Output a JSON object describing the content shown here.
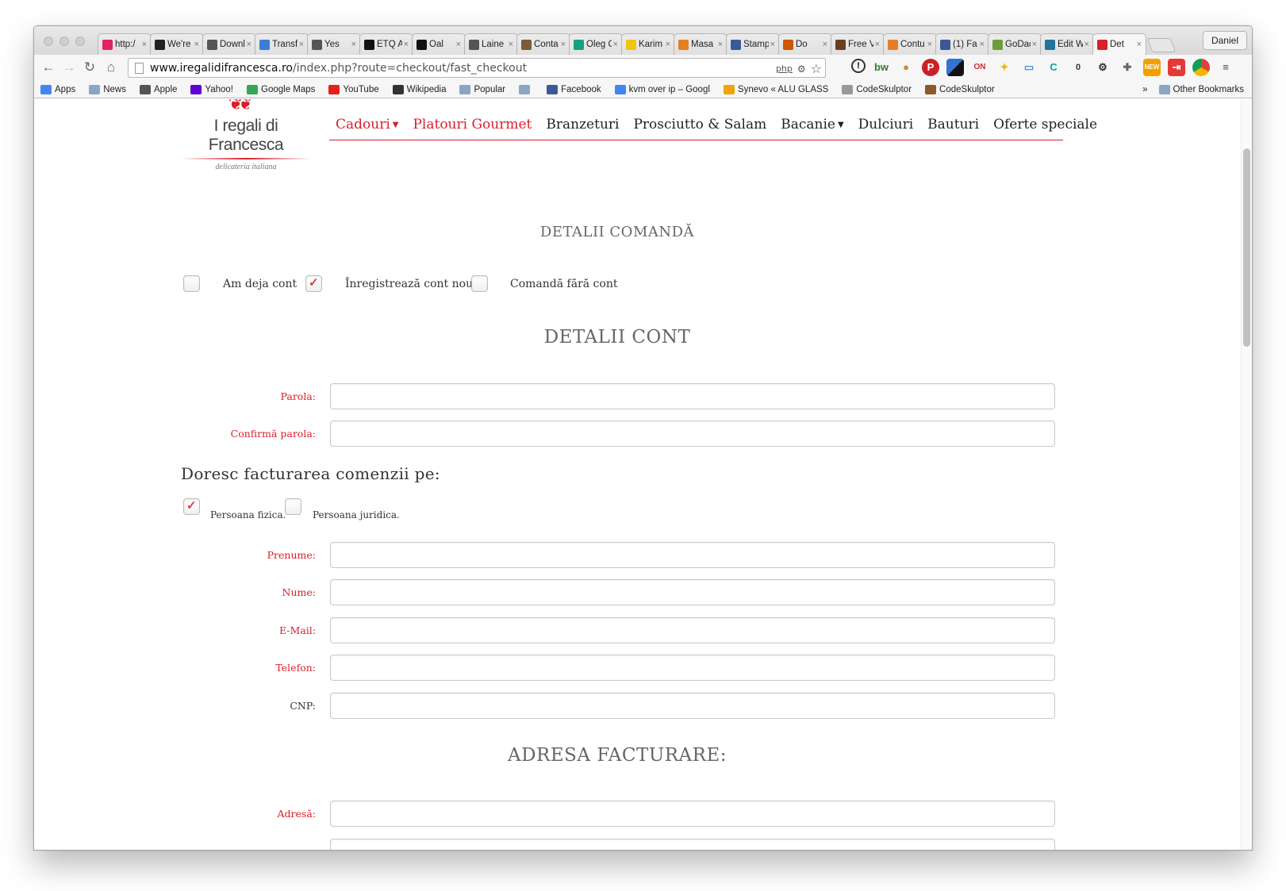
{
  "browser": {
    "tabs": [
      {
        "label": "http:/",
        "icon": "bookmark-icon",
        "color": "#e0245e"
      },
      {
        "label": "We're",
        "icon": "medium-icon",
        "color": "#222222"
      },
      {
        "label": "Downl",
        "icon": "download-icon",
        "color": "#555555"
      },
      {
        "label": "Transf",
        "icon": "triangle-icon",
        "color": "#3b7dd8"
      },
      {
        "label": "Yes",
        "icon": "circle-icon",
        "color": "#555555"
      },
      {
        "label": "ETQ A",
        "icon": "square-icon",
        "color": "#111111"
      },
      {
        "label": "Oal",
        "icon": "o-icon",
        "color": "#111111"
      },
      {
        "label": "Laine",
        "icon": "hand-icon",
        "color": "#555555"
      },
      {
        "label": "Conta",
        "icon": "lock-icon",
        "color": "#7a5b3a"
      },
      {
        "label": "Oleg C",
        "icon": "square-icon",
        "color": "#16a085"
      },
      {
        "label": "Karim",
        "icon": "plus-icon",
        "color": "#f1c40f"
      },
      {
        "label": "Masa",
        "icon": "olx-icon",
        "color": "#e67e22"
      },
      {
        "label": "Stamp",
        "icon": "stamp-icon",
        "color": "#3b5998"
      },
      {
        "label": "Do",
        "icon": "doc-icon",
        "color": "#d35400"
      },
      {
        "label": "Free V",
        "icon": "ffp-icon",
        "color": "#6b3e1f"
      },
      {
        "label": "Contu",
        "icon": "olx-icon",
        "color": "#e67e22"
      },
      {
        "label": "(1) Fa",
        "icon": "facebook-icon",
        "color": "#3b5998"
      },
      {
        "label": "GoDac",
        "icon": "godaddy-icon",
        "color": "#6b9e3a"
      },
      {
        "label": "Edit W",
        "icon": "wordpress-icon",
        "color": "#21759b"
      },
      {
        "label": "Det",
        "icon": "site-icon",
        "color": "#d91f2a"
      }
    ],
    "profile": "Daniel",
    "url_host": "www.iregalidifrancesca.ro",
    "url_path": "/index.php?route=checkout/fast_checkout",
    "omnibox_badge": "php",
    "bookmarks": [
      {
        "label": "Apps",
        "icon": "apps-grid-icon",
        "color": "#4285f4"
      },
      {
        "label": "News",
        "icon": "folder-icon",
        "color": "#8aa6c4"
      },
      {
        "label": "Apple",
        "icon": "apple-icon",
        "color": "#555555"
      },
      {
        "label": "Yahoo!",
        "icon": "yahoo-icon",
        "color": "#5f01d1"
      },
      {
        "label": "Google Maps",
        "icon": "maps-icon",
        "color": "#34a853"
      },
      {
        "label": "YouTube",
        "icon": "youtube-icon",
        "color": "#e62117"
      },
      {
        "label": "Wikipedia",
        "icon": "wikipedia-icon",
        "color": "#333333"
      },
      {
        "label": "Popular",
        "icon": "folder-icon",
        "color": "#8aa6c4"
      },
      {
        "label": "",
        "icon": "folder-icon",
        "color": "#8aa6c4"
      },
      {
        "label": "Facebook",
        "icon": "facebook-icon",
        "color": "#3b5998"
      },
      {
        "label": "kvm over ip – Googl",
        "icon": "google-icon",
        "color": "#4285f4"
      },
      {
        "label": "Synevo « ALU GLASS",
        "icon": "rss-icon",
        "color": "#f0a30a"
      },
      {
        "label": "CodeSkulptor",
        "icon": "page-icon",
        "color": "#999999"
      },
      {
        "label": "CodeSkulptor",
        "icon": "hammer-icon",
        "color": "#8b5a2b"
      }
    ],
    "bookmarks_more": "»",
    "other_bookmarks": "Other Bookmarks"
  },
  "site": {
    "logo_name": "I regali di Francesca",
    "logo_tagline": "delicateria italiana",
    "nav": [
      {
        "label": "Cadouri",
        "red": true,
        "caret": true
      },
      {
        "label": "Platouri Gourmet",
        "red": true,
        "caret": false
      },
      {
        "label": "Branzeturi",
        "red": false,
        "caret": false
      },
      {
        "label": "Prosciutto & Salam",
        "red": false,
        "caret": false
      },
      {
        "label": "Bacanie",
        "red": false,
        "caret": true
      },
      {
        "label": "Dulciuri",
        "red": false,
        "caret": false
      },
      {
        "label": "Bauturi",
        "red": false,
        "caret": false
      },
      {
        "label": "Oferte speciale",
        "red": false,
        "caret": false
      }
    ],
    "accent_color": "#d91f2a"
  },
  "checkout": {
    "order_details_title": "DETALII COMANDĂ",
    "account_options": [
      {
        "label": "Am deja cont",
        "checked": false
      },
      {
        "label": "Înregistrează cont nou",
        "checked": true
      },
      {
        "label": "Comandă fără cont",
        "checked": false
      }
    ],
    "account_details_title": "DETALII CONT",
    "password_label": "Parola:",
    "confirm_password_label": "Confirmă parola:",
    "billing_heading": "Doresc facturarea comenzii pe:",
    "billing_types": [
      {
        "label": "Persoana fizica.",
        "checked": true
      },
      {
        "label": "Persoana juridica.",
        "checked": false
      }
    ],
    "person_fields": [
      {
        "label": "Prenume:",
        "required": true,
        "value": ""
      },
      {
        "label": "Nume:",
        "required": true,
        "value": ""
      },
      {
        "label": "E-Mail:",
        "required": true,
        "value": ""
      },
      {
        "label": "Telefon:",
        "required": true,
        "value": ""
      },
      {
        "label": "CNP:",
        "required": false,
        "value": ""
      }
    ],
    "billing_address_title": "ADRESA FACTURARE:",
    "address_label": "Adresă:"
  }
}
